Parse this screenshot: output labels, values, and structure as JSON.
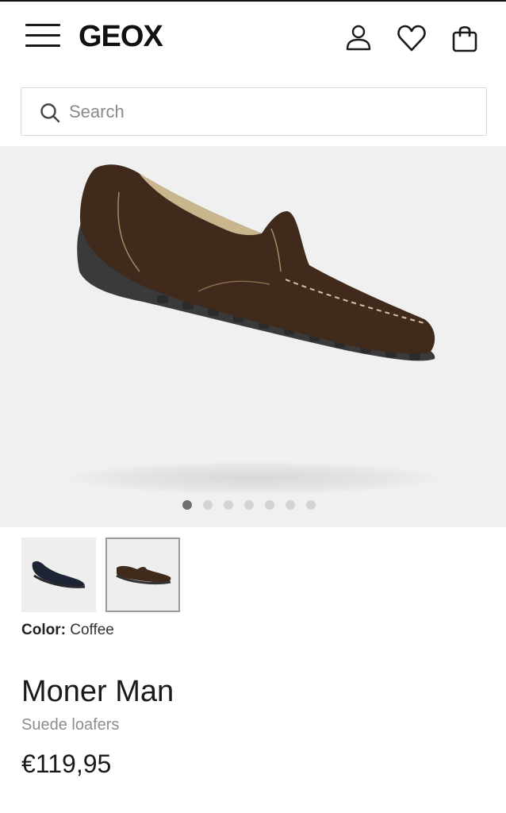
{
  "brand": "GEOX",
  "header": {
    "menu_icon": "hamburger-menu-icon",
    "account_icon": "user-icon",
    "wishlist_icon": "heart-icon",
    "bag_icon": "shopping-bag-icon"
  },
  "search": {
    "placeholder": "Search",
    "icon": "search-icon"
  },
  "gallery": {
    "image_count": 7,
    "active_index": 0
  },
  "variants": [
    {
      "color": "navy"
    },
    {
      "color": "coffee",
      "selected": true
    }
  ],
  "product": {
    "color_label": "Color:",
    "color_value": "Coffee",
    "name": "Moner Man",
    "subtitle": "Suede loafers",
    "price": "€119,95"
  },
  "colors": {
    "shoe_brown": "#3f2a1b",
    "sole": "#3a3a3a",
    "gallery_bg": "#f0f0f0"
  }
}
